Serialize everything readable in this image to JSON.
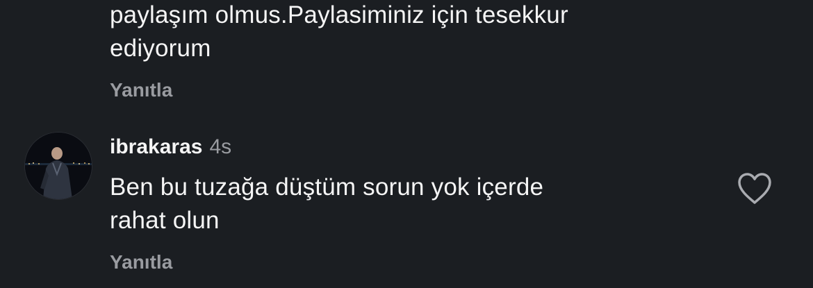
{
  "comments": [
    {
      "text": "paylaşım olmus.Paylasiminiz için tesekkur\nediyorum",
      "reply_label": "Yanıtla"
    },
    {
      "username": "ibrakaras",
      "timestamp": "4s",
      "text": "Ben bu tuzağa düştüm sorun yok içerde\nrahat olun",
      "reply_label": "Yanıtla",
      "like_icon": "heart-outline-icon"
    }
  ]
}
